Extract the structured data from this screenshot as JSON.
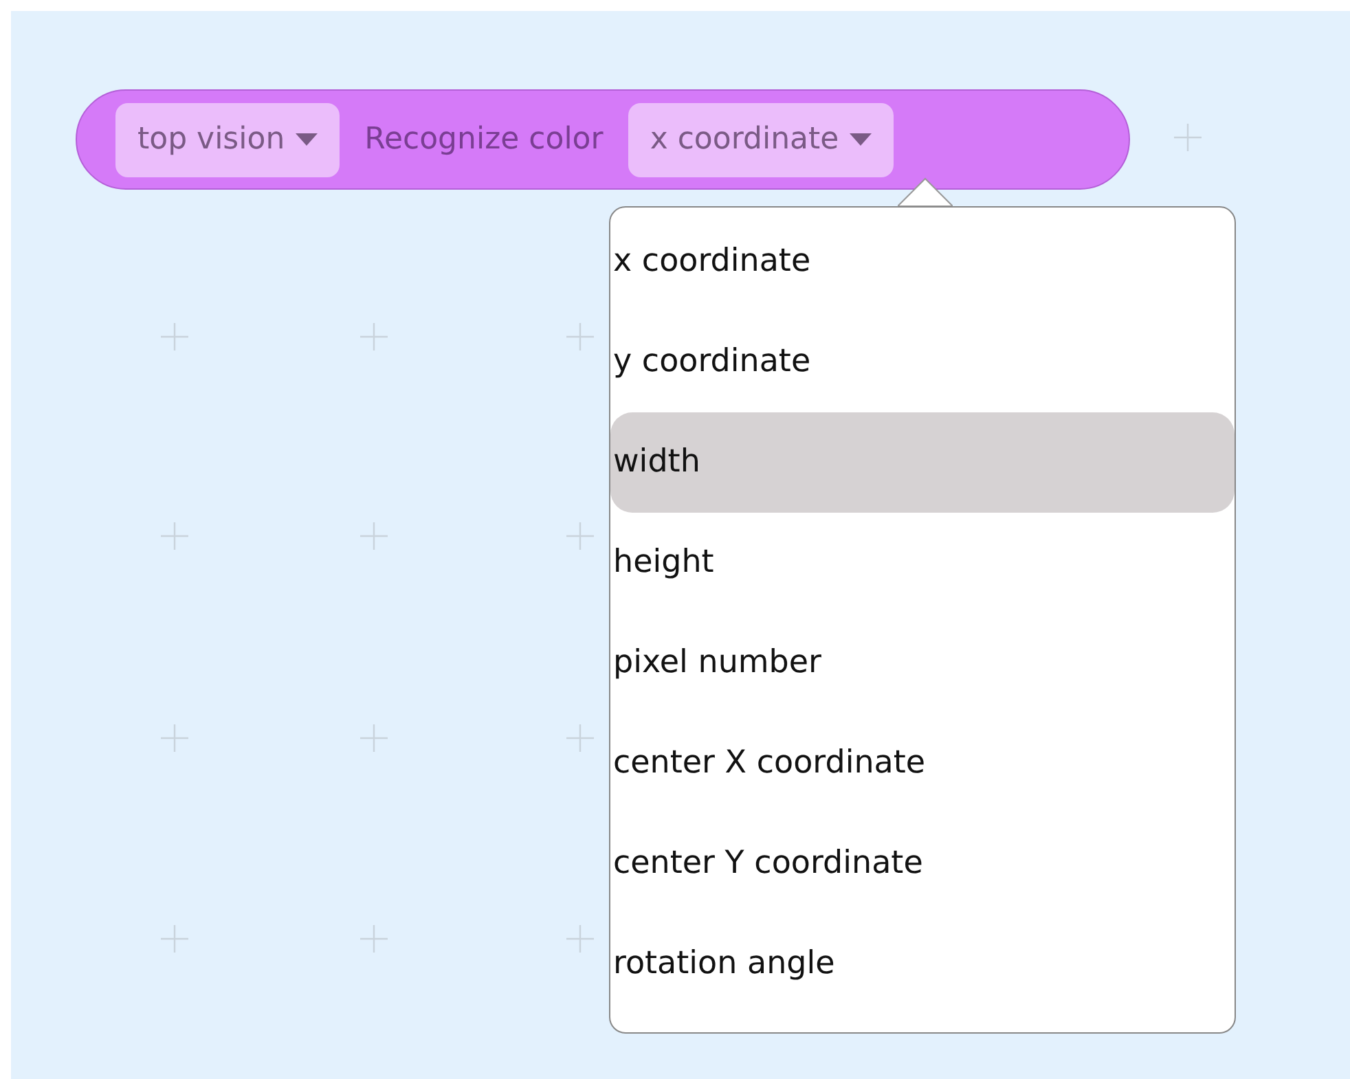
{
  "block": {
    "source_dropdown": {
      "value": "top vision"
    },
    "label": "Recognize color",
    "property_dropdown": {
      "value": "x coordinate",
      "expanded": true
    }
  },
  "menu": {
    "items": [
      {
        "label": "x coordinate",
        "selected": false
      },
      {
        "label": "y coordinate",
        "selected": false
      },
      {
        "label": "width",
        "selected": true
      },
      {
        "label": "height",
        "selected": false
      },
      {
        "label": "pixel number",
        "selected": false
      },
      {
        "label": "center X coordinate",
        "selected": false
      },
      {
        "label": "center Y coordinate",
        "selected": false
      },
      {
        "label": "rotation angle",
        "selected": false
      }
    ]
  }
}
